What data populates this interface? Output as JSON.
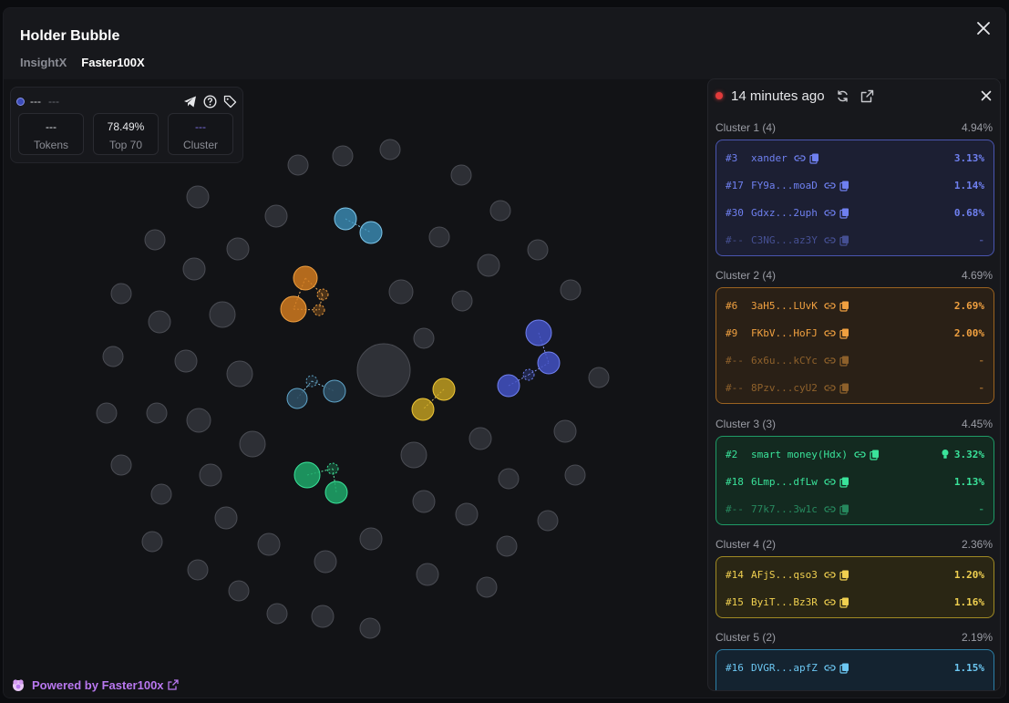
{
  "modal": {
    "title": "Holder Bubble",
    "tabs": [
      {
        "label": "InsightX",
        "active": false
      },
      {
        "label": "Faster100X",
        "active": true
      }
    ]
  },
  "info_card": {
    "address_primary": "---",
    "address_secondary": "---",
    "stats": [
      {
        "value": "---",
        "label": "Tokens"
      },
      {
        "value": "78.49%",
        "label": "Top 70"
      },
      {
        "value": "---",
        "label": "Cluster"
      }
    ]
  },
  "powered": {
    "prefix": "Powered by",
    "brand": "Faster100x"
  },
  "panel": {
    "updated": "14 minutes ago",
    "clusters": [
      {
        "header": "Cluster 1 (4)",
        "total": "4.94%",
        "color": "#5b6ee8",
        "rows": [
          {
            "rank": "#3",
            "name": "xander",
            "pct": "3.13%",
            "dim": false
          },
          {
            "rank": "#17",
            "name": "FY9a...moaD",
            "pct": "1.14%",
            "dim": false
          },
          {
            "rank": "#30",
            "name": "Gdxz...2uph",
            "pct": "0.68%",
            "dim": false
          },
          {
            "rank": "#--",
            "name": "C3NG...az3Y",
            "pct": "-",
            "dim": true
          }
        ]
      },
      {
        "header": "Cluster 2 (4)",
        "total": "4.69%",
        "color": "#e08a2a",
        "rows": [
          {
            "rank": "#6",
            "name": "3aH5...LUvK",
            "pct": "2.69%",
            "dim": false
          },
          {
            "rank": "#9",
            "name": "FKbV...HoFJ",
            "pct": "2.00%",
            "dim": false
          },
          {
            "rank": "#--",
            "name": "6x6u...kCYc",
            "pct": "-",
            "dim": true
          },
          {
            "rank": "#--",
            "name": "8Pzv...cyU2",
            "pct": "-",
            "dim": true
          }
        ]
      },
      {
        "header": "Cluster 3 (3)",
        "total": "4.45%",
        "color": "#2fd48a",
        "rows": [
          {
            "rank": "#2",
            "name": "smart money(Hdx)",
            "pct": "3.32%",
            "dim": false,
            "bulb": true
          },
          {
            "rank": "#18",
            "name": "6Lmp...dfLw",
            "pct": "1.13%",
            "dim": false
          },
          {
            "rank": "#--",
            "name": "77k7...3w1c",
            "pct": "-",
            "dim": true
          }
        ]
      },
      {
        "header": "Cluster 4 (2)",
        "total": "2.36%",
        "color": "#e6c23a",
        "rows": [
          {
            "rank": "#14",
            "name": "AFjS...qso3",
            "pct": "1.20%",
            "dim": false
          },
          {
            "rank": "#15",
            "name": "ByiT...Bz3R",
            "pct": "1.16%",
            "dim": false
          }
        ]
      },
      {
        "header": "Cluster 5 (2)",
        "total": "2.19%",
        "color": "#5ab8e8",
        "rows": [
          {
            "rank": "#16",
            "name": "DVGR...apfZ",
            "pct": "1.15%",
            "dim": false
          }
        ]
      }
    ]
  },
  "bubble_colors": {
    "neutral": "#33353b",
    "cluster1": "#4352c4",
    "cluster2": "#d07a1f",
    "cluster3": "#1ea86a",
    "cluster4": "#c9a520",
    "cluster5": "#3c8fb8"
  }
}
